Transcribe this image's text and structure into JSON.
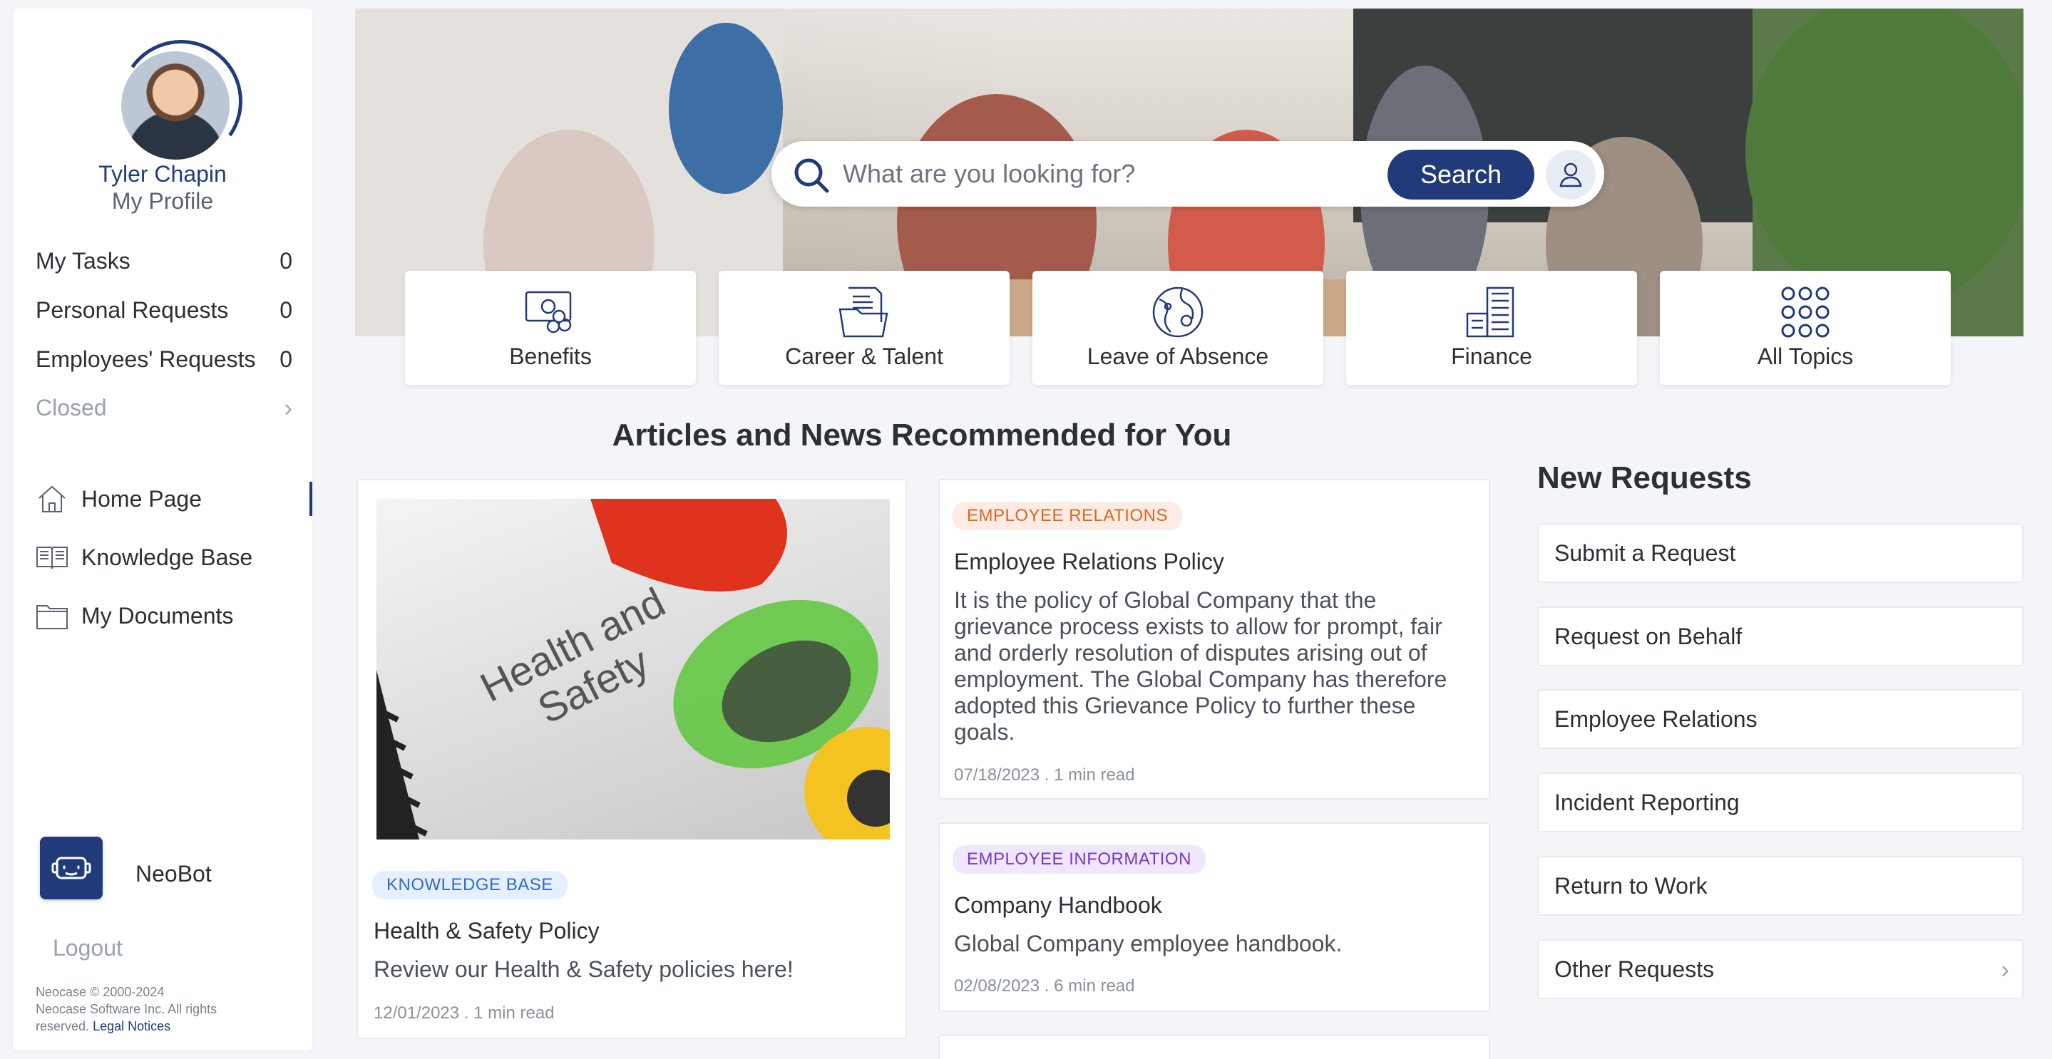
{
  "profile": {
    "name": "Tyler Chapin",
    "link": "My Profile"
  },
  "counters": [
    {
      "label": "My Tasks",
      "count": "0"
    },
    {
      "label": "Personal Requests",
      "count": "0"
    },
    {
      "label": "Employees' Requests",
      "count": "0"
    }
  ],
  "closed_label": "Closed",
  "nav": [
    {
      "label": "Home Page",
      "icon": "home-icon",
      "active": true
    },
    {
      "label": "Knowledge Base",
      "icon": "book-icon",
      "active": false
    },
    {
      "label": "My Documents",
      "icon": "folder-icon",
      "active": false
    }
  ],
  "neobot": {
    "label": "NeoBot",
    "icon": "robot-icon"
  },
  "logout_label": "Logout",
  "legal": {
    "line1": "Neocase © 2000-2024",
    "line2": "Neocase Software Inc. All rights reserved.",
    "link": "Legal Notices"
  },
  "search": {
    "placeholder": "What are you looking for?",
    "button": "Search"
  },
  "topics": [
    {
      "label": "Benefits",
      "icon": "money-coins-icon"
    },
    {
      "label": "Career & Talent",
      "icon": "folder-documents-icon"
    },
    {
      "label": "Leave of Absence",
      "icon": "globe-travel-icon"
    },
    {
      "label": "Finance",
      "icon": "building-calculator-icon"
    },
    {
      "label": "All Topics",
      "icon": "grid-dots-icon"
    }
  ],
  "articles_title": "Articles and News Recommended for You",
  "articles": [
    {
      "tag": "KNOWLEDGE BASE",
      "title": "Health & Safety Policy",
      "summary": "Review our Health & Safety policies here!",
      "date": "12/01/2023",
      "sep": ".",
      "read": "1 min read",
      "image_text": "Health and Safety"
    },
    {
      "tag": "EMPLOYEE RELATIONS",
      "title": "Employee Relations Policy",
      "summary": "It is the policy of Global Company that the grievance process exists to allow for prompt, fair and orderly resolution of disputes arising out of employment. The Global Company has therefore adopted this Grievance Policy to further these goals.",
      "date": "07/18/2023",
      "sep": ".",
      "read": "1 min read"
    },
    {
      "tag": "EMPLOYEE INFORMATION",
      "title": "Company Handbook",
      "summary": "Global Company employee handbook.",
      "date": "02/08/2023",
      "sep": ".",
      "read": "6 min read"
    }
  ],
  "new_requests": {
    "title": "New Requests",
    "items": [
      "Submit a Request",
      "Request on Behalf",
      "Employee Relations",
      "Incident Reporting",
      "Return to Work",
      "Other Requests"
    ]
  },
  "colors": {
    "brand": "#213a79",
    "kb_tag": "#2f6ad0",
    "er_tag": "#e0641f",
    "ei_tag": "#7a35c9"
  }
}
